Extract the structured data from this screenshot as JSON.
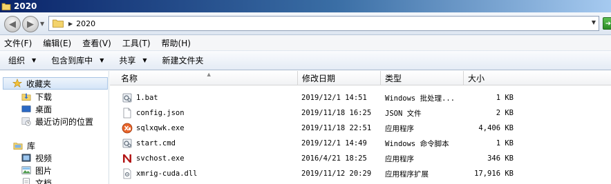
{
  "window": {
    "title": "2020"
  },
  "address": {
    "path": "2020"
  },
  "menu": [
    {
      "label": "文件(F)"
    },
    {
      "label": "编辑(E)"
    },
    {
      "label": "查看(V)"
    },
    {
      "label": "工具(T)"
    },
    {
      "label": "帮助(H)"
    }
  ],
  "toolbar": {
    "organize": "组织",
    "include_library": "包含到库中",
    "share": "共享",
    "new_folder": "新建文件夹"
  },
  "nav": {
    "favorites": "收藏夹",
    "downloads": "下载",
    "desktop": "桌面",
    "recent": "最近访问的位置",
    "libraries": "库",
    "videos": "视频",
    "pictures": "图片",
    "documents": "文档"
  },
  "columns": {
    "name": "名称",
    "date": "修改日期",
    "type": "类型",
    "size": "大小"
  },
  "files": [
    {
      "name": "1.bat",
      "date": "2019/12/1 14:51",
      "type": "Windows 批处理...",
      "size": "1 KB",
      "icon": "batch-file-icon"
    },
    {
      "name": "config.json",
      "date": "2019/11/18 16:25",
      "type": "JSON 文件",
      "size": "2 KB",
      "icon": "json-file-icon"
    },
    {
      "name": "sqlxqwk.exe",
      "date": "2019/11/18 22:51",
      "type": "应用程序",
      "size": "4,406 KB",
      "icon": "xmrig-exe-icon"
    },
    {
      "name": "start.cmd",
      "date": "2019/12/1 14:49",
      "type": "Windows 命令脚本",
      "size": "1 KB",
      "icon": "cmd-file-icon"
    },
    {
      "name": "svchost.exe",
      "date": "2016/4/21 18:25",
      "type": "应用程序",
      "size": "346 KB",
      "icon": "n-exe-icon"
    },
    {
      "name": "xmrig-cuda.dll",
      "date": "2019/11/12 20:29",
      "type": "应用程序扩展",
      "size": "17,916 KB",
      "icon": "dll-file-icon"
    }
  ]
}
